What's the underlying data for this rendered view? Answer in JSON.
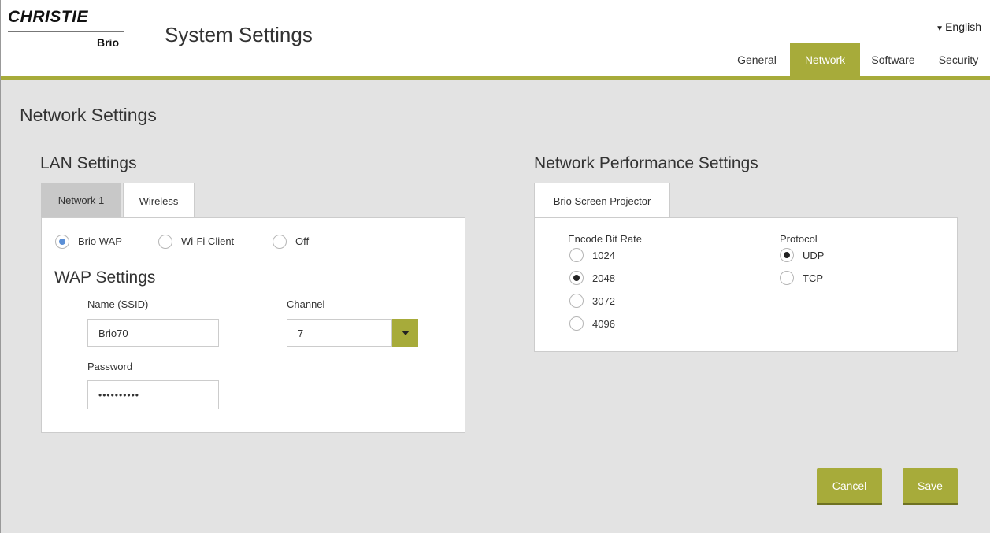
{
  "brand": {
    "logo_text": "CHRISTIE",
    "logo_sub": "Brio"
  },
  "header": {
    "title": "System Settings",
    "language": "English",
    "nav_tabs": [
      {
        "label": "General",
        "active": false
      },
      {
        "label": "Network",
        "active": true
      },
      {
        "label": "Software",
        "active": false
      },
      {
        "label": "Security",
        "active": false
      }
    ]
  },
  "page": {
    "title": "Network Settings"
  },
  "lan": {
    "title": "LAN Settings",
    "tabs": [
      {
        "label": "Network 1",
        "active": false
      },
      {
        "label": "Wireless",
        "active": true
      }
    ],
    "modes": [
      {
        "label": "Brio WAP",
        "checked": true
      },
      {
        "label": "Wi-Fi Client",
        "checked": false
      },
      {
        "label": "Off",
        "checked": false
      }
    ],
    "wap": {
      "title": "WAP Settings",
      "ssid_label": "Name (SSID)",
      "ssid_value": "Brio70",
      "channel_label": "Channel",
      "channel_value": "7",
      "password_label": "Password",
      "password_value": "••••••••••"
    }
  },
  "performance": {
    "title": "Network Performance Settings",
    "tab": "Brio Screen Projector",
    "bitrate": {
      "label": "Encode Bit Rate",
      "options": [
        {
          "label": "1024",
          "checked": false
        },
        {
          "label": "2048",
          "checked": true
        },
        {
          "label": "3072",
          "checked": false
        },
        {
          "label": "4096",
          "checked": false
        }
      ]
    },
    "protocol": {
      "label": "Protocol",
      "options": [
        {
          "label": "UDP",
          "checked": true
        },
        {
          "label": "TCP",
          "checked": false
        }
      ]
    }
  },
  "actions": {
    "cancel": "Cancel",
    "save": "Save"
  },
  "colors": {
    "accent": "#a7ab3a",
    "background": "#e3e3e3",
    "radio_blue": "#5b8fd6"
  }
}
